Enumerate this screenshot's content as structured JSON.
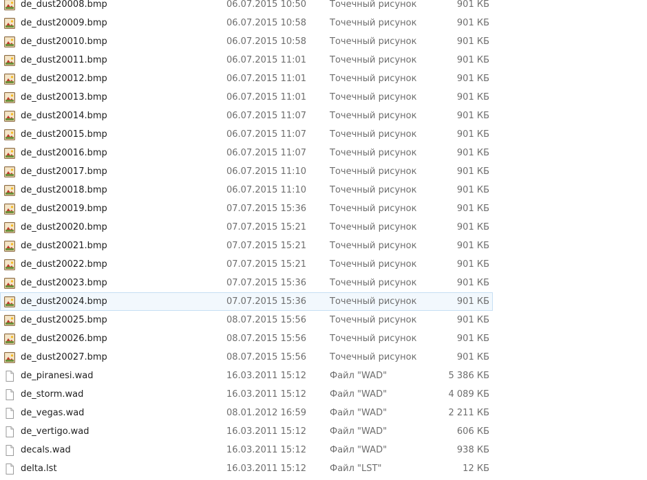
{
  "files": [
    {
      "name": "de_dust20008.bmp",
      "date": "06.07.2015 10:50",
      "type": "Точечный рисунок",
      "size": "901 КБ",
      "icon": "bitmap-image-icon"
    },
    {
      "name": "de_dust20009.bmp",
      "date": "06.07.2015 10:58",
      "type": "Точечный рисунок",
      "size": "901 КБ",
      "icon": "bitmap-image-icon"
    },
    {
      "name": "de_dust20010.bmp",
      "date": "06.07.2015 10:58",
      "type": "Точечный рисунок",
      "size": "901 КБ",
      "icon": "bitmap-image-icon"
    },
    {
      "name": "de_dust20011.bmp",
      "date": "06.07.2015 11:01",
      "type": "Точечный рисунок",
      "size": "901 КБ",
      "icon": "bitmap-image-icon"
    },
    {
      "name": "de_dust20012.bmp",
      "date": "06.07.2015 11:01",
      "type": "Точечный рисунок",
      "size": "901 КБ",
      "icon": "bitmap-image-icon"
    },
    {
      "name": "de_dust20013.bmp",
      "date": "06.07.2015 11:01",
      "type": "Точечный рисунок",
      "size": "901 КБ",
      "icon": "bitmap-image-icon"
    },
    {
      "name": "de_dust20014.bmp",
      "date": "06.07.2015 11:07",
      "type": "Точечный рисунок",
      "size": "901 КБ",
      "icon": "bitmap-image-icon"
    },
    {
      "name": "de_dust20015.bmp",
      "date": "06.07.2015 11:07",
      "type": "Точечный рисунок",
      "size": "901 КБ",
      "icon": "bitmap-image-icon"
    },
    {
      "name": "de_dust20016.bmp",
      "date": "06.07.2015 11:07",
      "type": "Точечный рисунок",
      "size": "901 КБ",
      "icon": "bitmap-image-icon"
    },
    {
      "name": "de_dust20017.bmp",
      "date": "06.07.2015 11:10",
      "type": "Точечный рисунок",
      "size": "901 КБ",
      "icon": "bitmap-image-icon"
    },
    {
      "name": "de_dust20018.bmp",
      "date": "06.07.2015 11:10",
      "type": "Точечный рисунок",
      "size": "901 КБ",
      "icon": "bitmap-image-icon"
    },
    {
      "name": "de_dust20019.bmp",
      "date": "07.07.2015 15:36",
      "type": "Точечный рисунок",
      "size": "901 КБ",
      "icon": "bitmap-image-icon"
    },
    {
      "name": "de_dust20020.bmp",
      "date": "07.07.2015 15:21",
      "type": "Точечный рисунок",
      "size": "901 КБ",
      "icon": "bitmap-image-icon"
    },
    {
      "name": "de_dust20021.bmp",
      "date": "07.07.2015 15:21",
      "type": "Точечный рисунок",
      "size": "901 КБ",
      "icon": "bitmap-image-icon"
    },
    {
      "name": "de_dust20022.bmp",
      "date": "07.07.2015 15:21",
      "type": "Точечный рисунок",
      "size": "901 КБ",
      "icon": "bitmap-image-icon"
    },
    {
      "name": "de_dust20023.bmp",
      "date": "07.07.2015 15:36",
      "type": "Точечный рисунок",
      "size": "901 КБ",
      "icon": "bitmap-image-icon"
    },
    {
      "name": "de_dust20024.bmp",
      "date": "07.07.2015 15:36",
      "type": "Точечный рисунок",
      "size": "901 КБ",
      "icon": "bitmap-image-icon",
      "selected": true
    },
    {
      "name": "de_dust20025.bmp",
      "date": "08.07.2015 15:56",
      "type": "Точечный рисунок",
      "size": "901 КБ",
      "icon": "bitmap-image-icon"
    },
    {
      "name": "de_dust20026.bmp",
      "date": "08.07.2015 15:56",
      "type": "Точечный рисунок",
      "size": "901 КБ",
      "icon": "bitmap-image-icon"
    },
    {
      "name": "de_dust20027.bmp",
      "date": "08.07.2015 15:56",
      "type": "Точечный рисунок",
      "size": "901 КБ",
      "icon": "bitmap-image-icon"
    },
    {
      "name": "de_piranesi.wad",
      "date": "16.03.2011 15:12",
      "type": "Файл \"WAD\"",
      "size": "5 386 КБ",
      "icon": "blank-file-icon"
    },
    {
      "name": "de_storm.wad",
      "date": "16.03.2011 15:12",
      "type": "Файл \"WAD\"",
      "size": "4 089 КБ",
      "icon": "blank-file-icon"
    },
    {
      "name": "de_vegas.wad",
      "date": "08.01.2012 16:59",
      "type": "Файл \"WAD\"",
      "size": "2 211 КБ",
      "icon": "blank-file-icon"
    },
    {
      "name": "de_vertigo.wad",
      "date": "16.03.2011 15:12",
      "type": "Файл \"WAD\"",
      "size": "606 КБ",
      "icon": "blank-file-icon"
    },
    {
      "name": "decals.wad",
      "date": "16.03.2011 15:12",
      "type": "Файл \"WAD\"",
      "size": "938 КБ",
      "icon": "blank-file-icon"
    },
    {
      "name": "delta.lst",
      "date": "16.03.2011 15:12",
      "type": "Файл \"LST\"",
      "size": "12 КБ",
      "icon": "blank-file-icon"
    }
  ],
  "colors": {
    "selected_background": "#f2f8fd",
    "selected_border": "#c6dff3",
    "secondary_text": "#6d6d6d"
  }
}
